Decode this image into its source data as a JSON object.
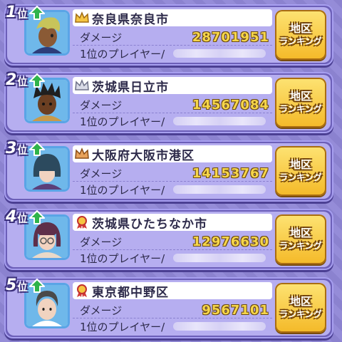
{
  "area_button": {
    "line1": "地区",
    "line2": "ランキング"
  },
  "labels": {
    "damage": "ダメージ",
    "top_player": "1位のプレイヤー/"
  },
  "entries": [
    {
      "rank": "1",
      "suffix": "位",
      "trend": "up",
      "badge": "gold-crown",
      "area": "奈良県奈良市",
      "damage": "28701951"
    },
    {
      "rank": "2",
      "suffix": "位",
      "trend": "up",
      "badge": "silver-crown",
      "area": "茨城県日立市",
      "damage": "14567084"
    },
    {
      "rank": "3",
      "suffix": "位",
      "trend": "up",
      "badge": "bronze-crown",
      "area": "大阪府大阪市港区",
      "damage": "14153767"
    },
    {
      "rank": "4",
      "suffix": "位",
      "trend": "up",
      "badge": "ribbon-medal",
      "area": "茨城県ひたちなか市",
      "damage": "12976630"
    },
    {
      "rank": "5",
      "suffix": "位",
      "trend": "up",
      "badge": "ribbon-medal",
      "area": "東京都中野区",
      "damage": "9567101"
    }
  ],
  "colors": {
    "background": "#8f86d6",
    "card": "#6c5fb8",
    "damage_digits": "#f6d64a",
    "button": "#f4b928",
    "trend_up": "#2fb34a"
  }
}
